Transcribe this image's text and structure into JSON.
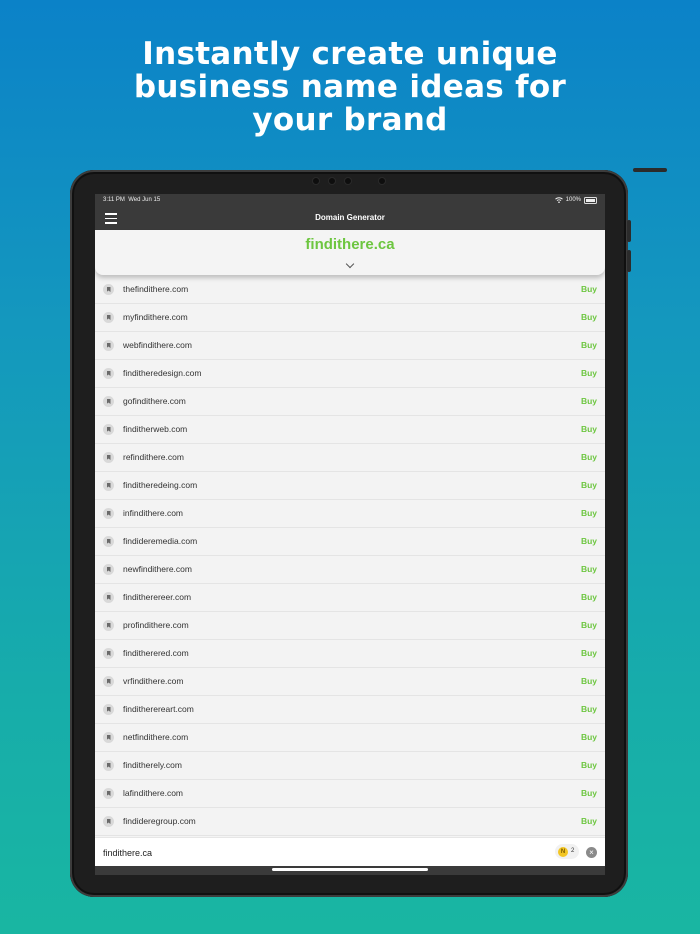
{
  "headline": {
    "line1": "Instantly create unique",
    "line2": "business name ideas for",
    "line3": "your brand"
  },
  "status_bar": {
    "time": "3:11 PM",
    "date": "Wed Jun 15",
    "battery": "100%"
  },
  "nav": {
    "title": "Domain Generator",
    "menu_icon": "hamburger-menu-icon"
  },
  "domain": {
    "name": "findithere.ca",
    "expand_icon": "chevron-down-icon"
  },
  "colors": {
    "accent_green": "#6dc640",
    "navbar": "#3a3a3a"
  },
  "results": [
    {
      "name": "thefindithere.com",
      "action": "Buy"
    },
    {
      "name": "myfindithere.com",
      "action": "Buy"
    },
    {
      "name": "webfindithere.com",
      "action": "Buy"
    },
    {
      "name": "finditheredesign.com",
      "action": "Buy"
    },
    {
      "name": "gofindithere.com",
      "action": "Buy"
    },
    {
      "name": "finditherweb.com",
      "action": "Buy"
    },
    {
      "name": "refindithere.com",
      "action": "Buy"
    },
    {
      "name": "finditheredeing.com",
      "action": "Buy"
    },
    {
      "name": "infindithere.com",
      "action": "Buy"
    },
    {
      "name": "findideremedia.com",
      "action": "Buy"
    },
    {
      "name": "newfindithere.com",
      "action": "Buy"
    },
    {
      "name": "finditherereer.com",
      "action": "Buy"
    },
    {
      "name": "profindithere.com",
      "action": "Buy"
    },
    {
      "name": "finditherered.com",
      "action": "Buy"
    },
    {
      "name": "vrfindithere.com",
      "action": "Buy"
    },
    {
      "name": "finditherereart.com",
      "action": "Buy"
    },
    {
      "name": "netfindithere.com",
      "action": "Buy"
    },
    {
      "name": "finditherely.com",
      "action": "Buy"
    },
    {
      "name": "lafindithere.com",
      "action": "Buy"
    },
    {
      "name": "findideregroup.com",
      "action": "Buy"
    }
  ],
  "input_bar": {
    "value": "findithere.ca",
    "coin_label": "N",
    "coin_count": "2",
    "clear_icon": "close-icon"
  }
}
